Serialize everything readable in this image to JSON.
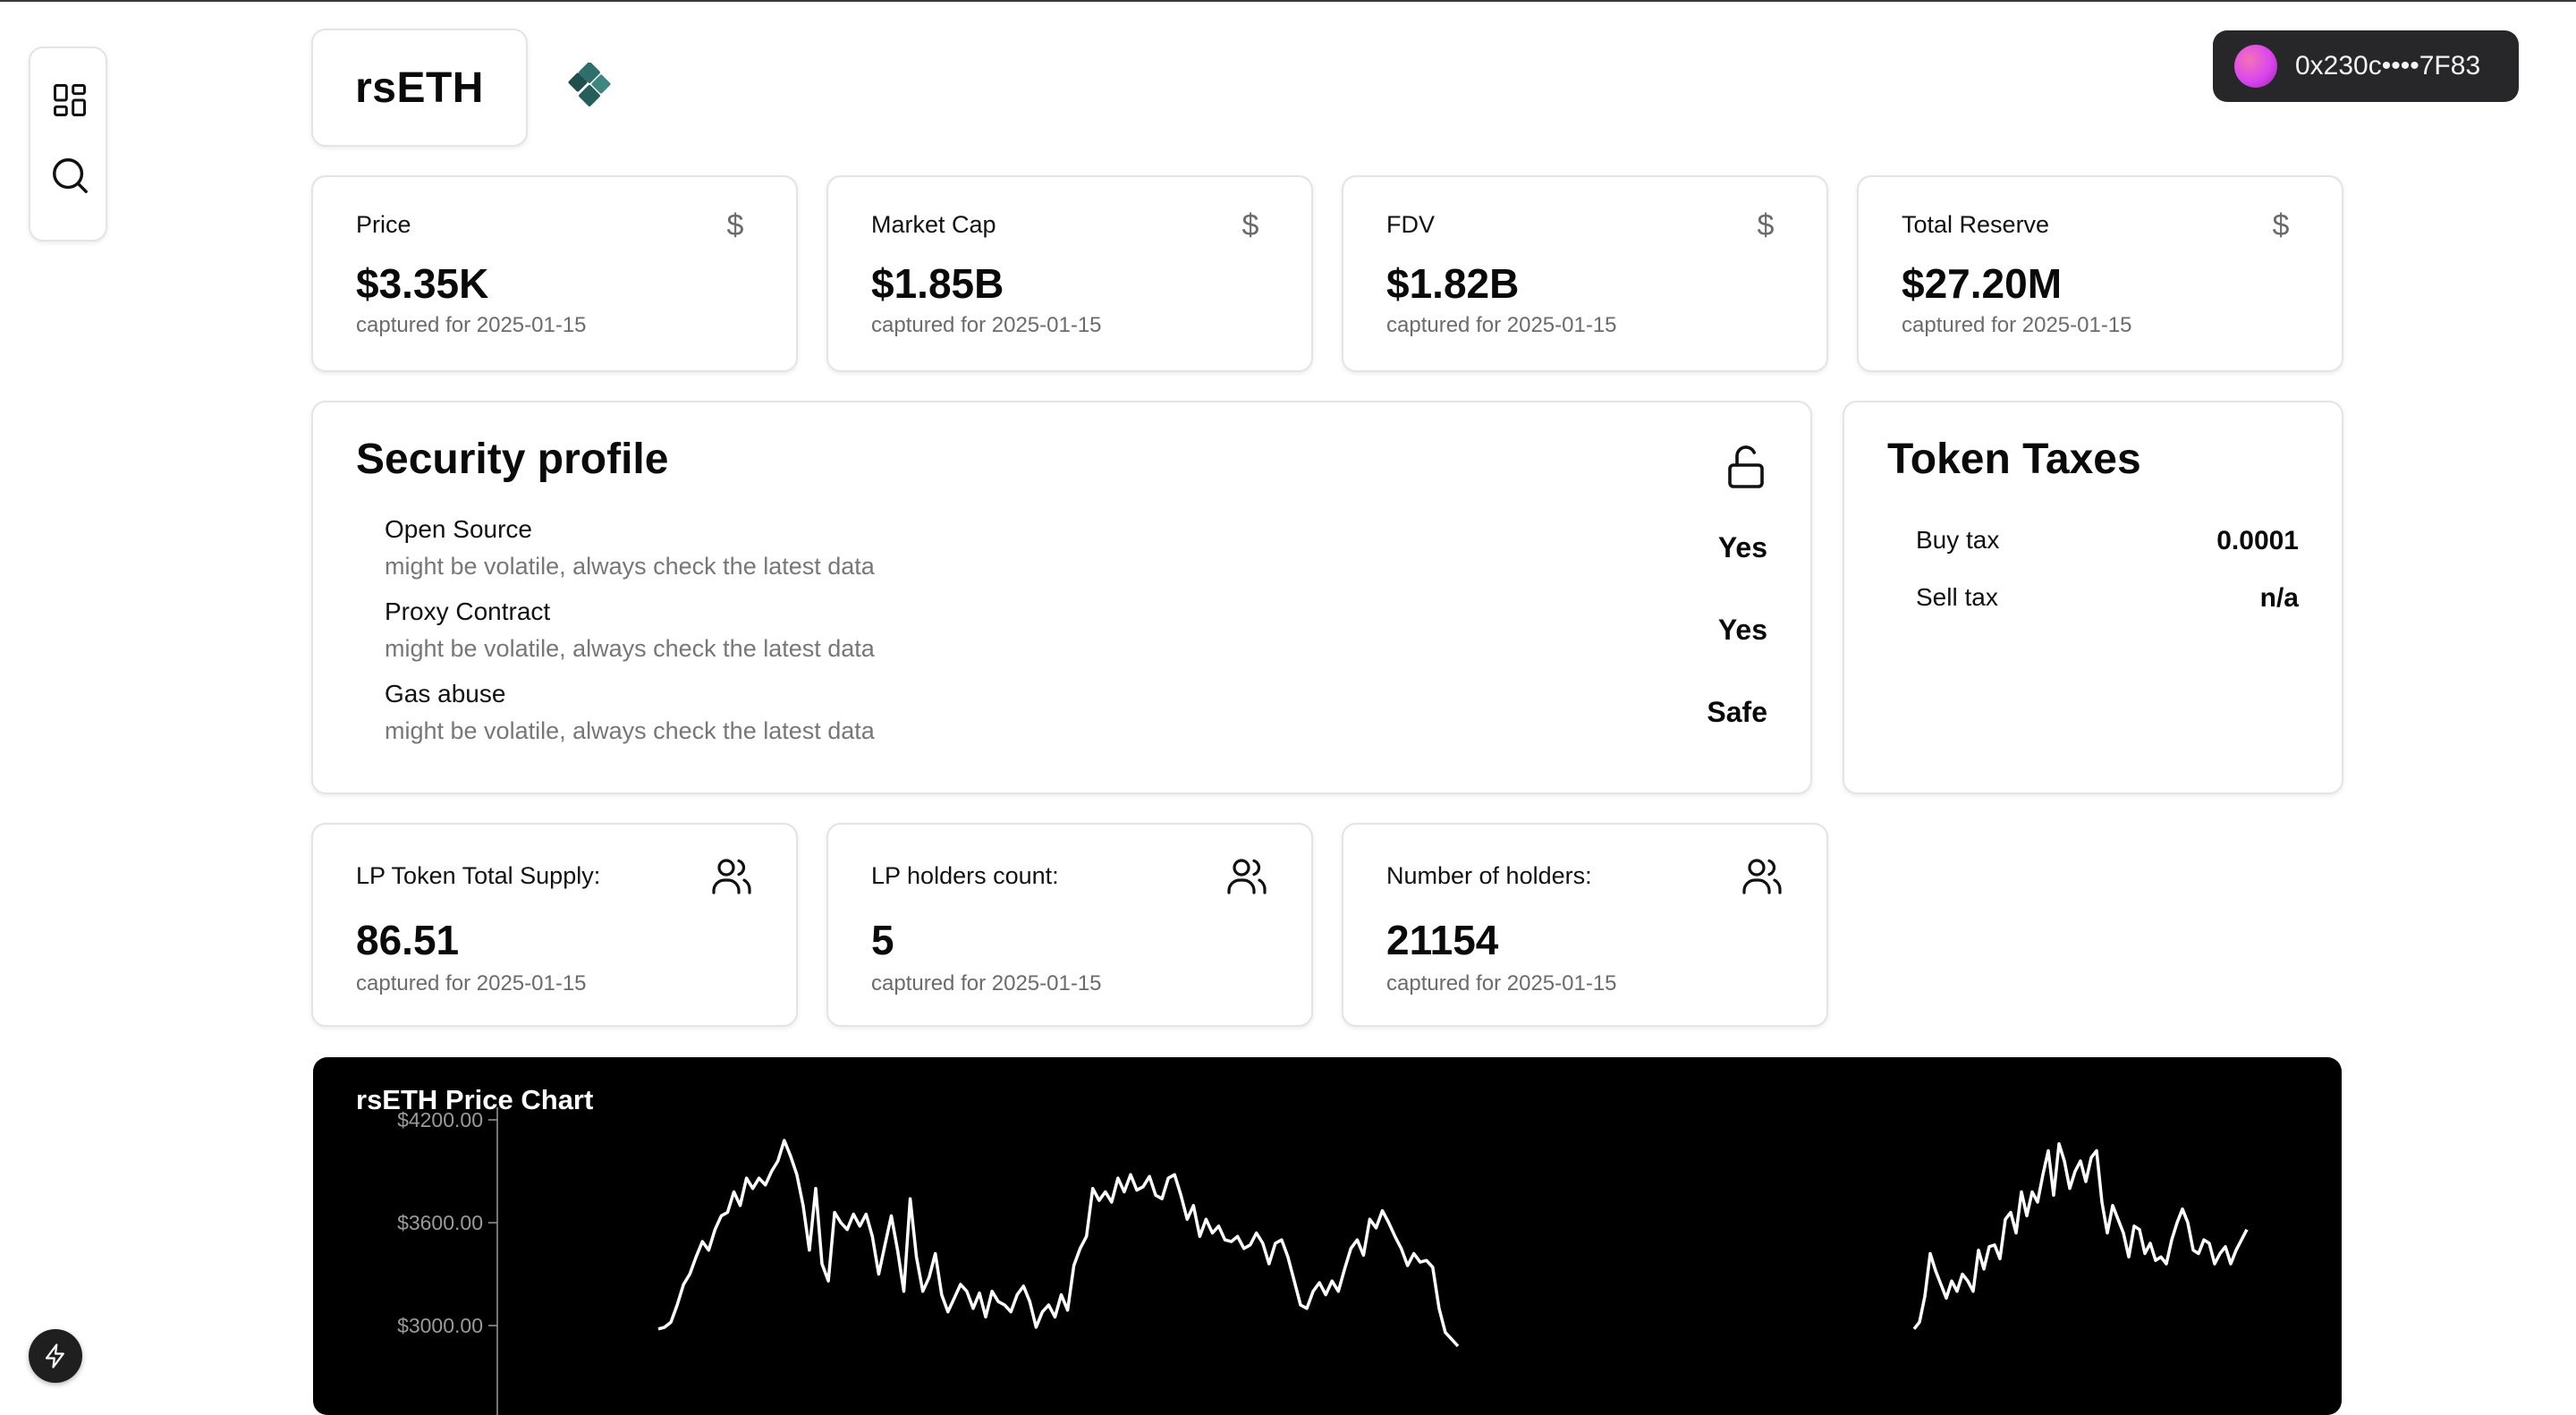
{
  "header": {
    "token_name": "rsETH",
    "wallet_address": "0x230c••••7F83"
  },
  "icons": {
    "rail": [
      "dashboard-grid-icon",
      "search-icon"
    ],
    "bottom": "bolt-icon",
    "token_logo": "kelp-dao-logo",
    "stat": "dollar-icon",
    "holders": "users-icon",
    "security": "unlock-icon"
  },
  "stats": [
    {
      "label": "Price",
      "value": "$3.35K",
      "caption": "captured for 2025-01-15"
    },
    {
      "label": "Market Cap",
      "value": "$1.85B",
      "caption": "captured for 2025-01-15"
    },
    {
      "label": "FDV",
      "value": "$1.82B",
      "caption": "captured for 2025-01-15"
    },
    {
      "label": "Total Reserve",
      "value": "$27.20M",
      "caption": "captured for 2025-01-15"
    }
  ],
  "security": {
    "title": "Security profile",
    "rows": [
      {
        "name": "Open Source",
        "note": "might be volatile, always check the latest data",
        "result": "Yes"
      },
      {
        "name": "Proxy Contract",
        "note": "might be volatile, always check the latest data",
        "result": "Yes"
      },
      {
        "name": "Gas abuse",
        "note": "might be volatile, always check the latest data",
        "result": "Safe"
      }
    ]
  },
  "taxes": {
    "title": "Token Taxes",
    "rows": [
      {
        "label": "Buy tax",
        "value": "0.0001"
      },
      {
        "label": "Sell tax",
        "value": "n/a"
      }
    ]
  },
  "holders": [
    {
      "label": "LP Token Total Supply:",
      "value": "86.51",
      "caption": "captured for 2025-01-15"
    },
    {
      "label": "LP holders count:",
      "value": "5",
      "caption": "captured for 2025-01-15"
    },
    {
      "label": "Number of holders:",
      "value": "21154",
      "caption": "captured for 2025-01-15"
    }
  ],
  "colors": {
    "accent_logo": "#1f5c5c",
    "wallet_bg": "#27272a",
    "chart_bg": "#000000",
    "line": "#ffffff"
  },
  "chart_data": {
    "type": "line",
    "title": "rsETH Price Chart",
    "ylabel": "",
    "yticks": [
      "$4200.00",
      "$3600.00",
      "$3000.00"
    ],
    "ytick_values": [
      4200,
      3600,
      3000
    ],
    "ylim": [
      2880,
      4270
    ],
    "series": [
      {
        "values": [
          2980,
          2990,
          3020,
          3120,
          3240,
          3300,
          3400,
          3490,
          3440,
          3560,
          3640,
          3660,
          3780,
          3700,
          3860,
          3800,
          3860,
          3820,
          3900,
          3960,
          4080,
          3990,
          3880,
          3700,
          3440,
          3800,
          3360,
          3260,
          3660,
          3600,
          3560,
          3650,
          3580,
          3650,
          3520,
          3300,
          3470,
          3640,
          3440,
          3200,
          3740,
          3400,
          3200,
          3280,
          3420,
          3180,
          3080,
          3160,
          3240,
          3200,
          3100,
          3190,
          3050,
          3200,
          3140,
          3120,
          3080,
          3180,
          3230,
          3140,
          2990,
          3080,
          3120,
          3050,
          3180,
          3090,
          3350,
          3450,
          3520,
          3800,
          3730,
          3780,
          3720,
          3860,
          3780,
          3880,
          3790,
          3810,
          3870,
          3760,
          3740,
          3860,
          3880,
          3760,
          3620,
          3700,
          3520,
          3620,
          3540,
          3580,
          3500,
          3490,
          3520,
          3450,
          3470,
          3540,
          3480,
          3360,
          3480,
          3500,
          3400,
          3260,
          3120,
          3100,
          3200,
          3250,
          3180,
          3260,
          3200,
          3330,
          3450,
          3500,
          3410,
          3620,
          3570,
          3670,
          3600,
          3520,
          3450,
          3350,
          3420,
          3370,
          3380,
          3340,
          3100,
          2960,
          2920,
          2880
        ]
      },
      {
        "values": [
          2980,
          3020,
          3170,
          3420,
          3320,
          3240,
          3160,
          3260,
          3200,
          3300,
          3260,
          3200,
          3440,
          3330,
          3460,
          3470,
          3390,
          3620,
          3660,
          3540,
          3780,
          3640,
          3780,
          3720,
          3880,
          4020,
          3760,
          4060,
          3960,
          3800,
          3900,
          3960,
          3840,
          3980,
          4020,
          3720,
          3540,
          3700,
          3620,
          3540,
          3400,
          3580,
          3560,
          3420,
          3480,
          3380,
          3400,
          3360,
          3500,
          3600,
          3680,
          3600,
          3440,
          3420,
          3500,
          3480,
          3360,
          3420,
          3460,
          3360,
          3440,
          3500,
          3560
        ]
      }
    ]
  }
}
